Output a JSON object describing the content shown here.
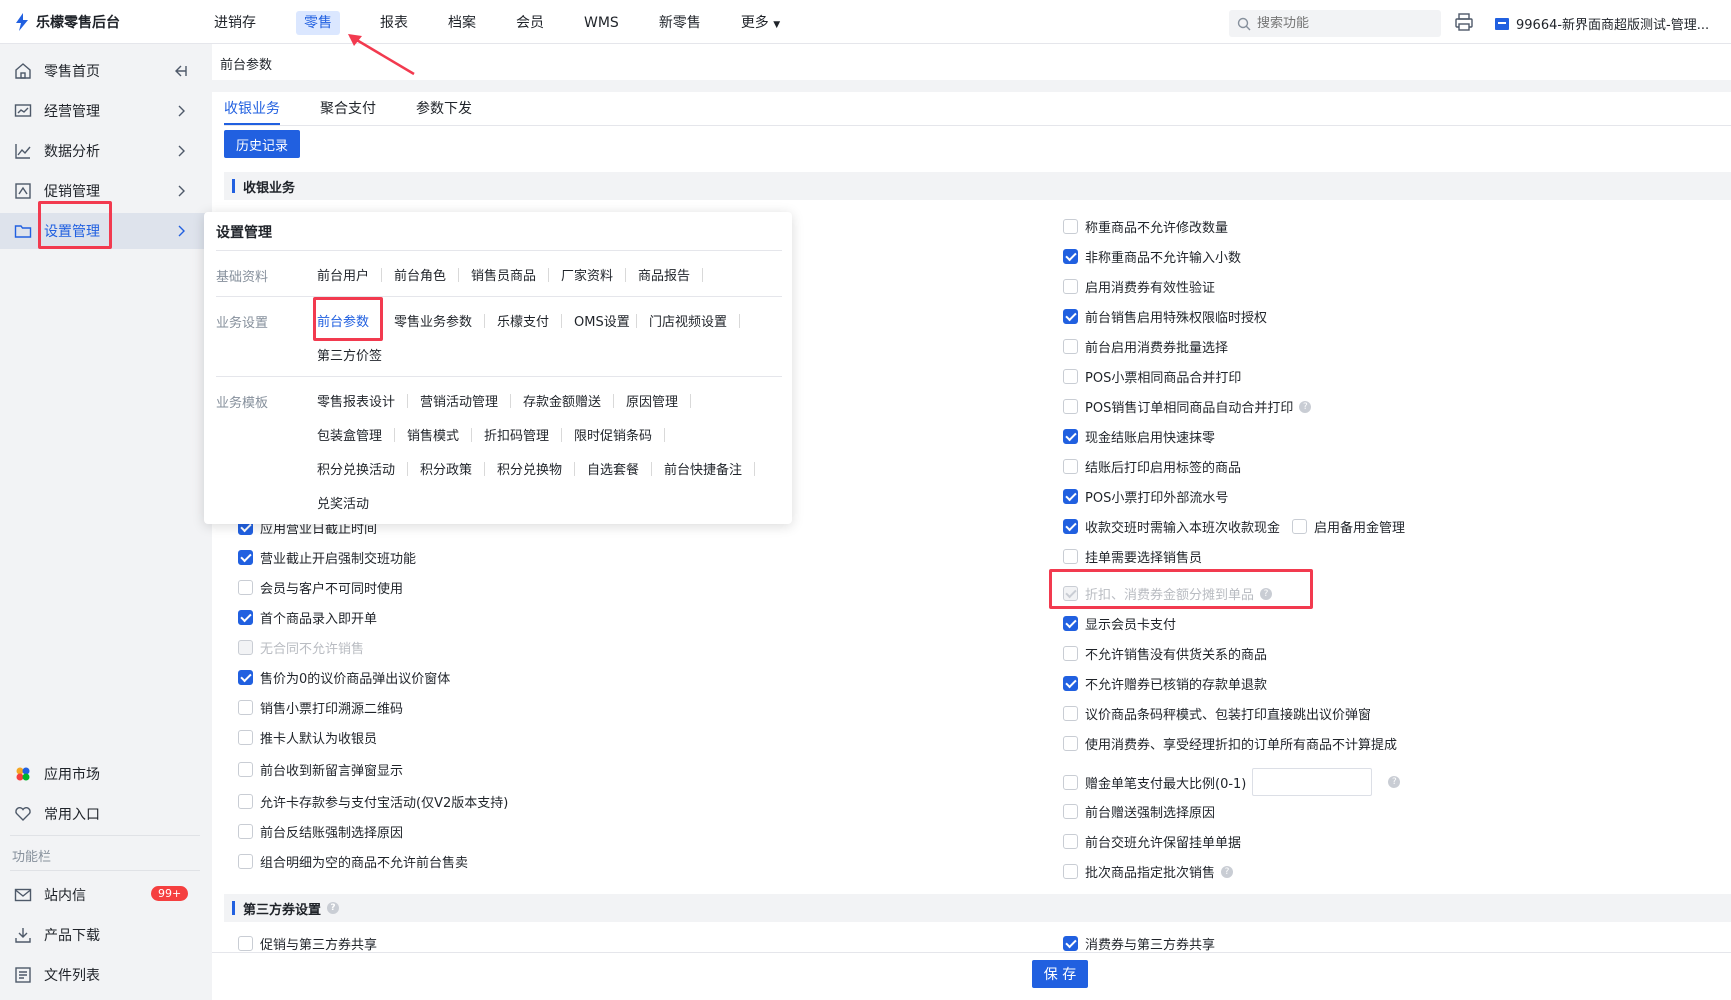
{
  "brand": {
    "name": "乐檬零售后台"
  },
  "topnav": {
    "items": [
      "进销存",
      "零售",
      "报表",
      "档案",
      "会员",
      "WMS",
      "新零售",
      "更多"
    ],
    "active": 1
  },
  "search": {
    "placeholder": "搜索功能"
  },
  "store": {
    "label": "99664-新界面商超版测试-管理..."
  },
  "sidebar": {
    "items": [
      {
        "label": "零售首页"
      },
      {
        "label": "经营管理"
      },
      {
        "label": "数据分析"
      },
      {
        "label": "促销管理"
      },
      {
        "label": "设置管理"
      }
    ],
    "bottom": [
      {
        "label": "应用市场"
      },
      {
        "label": "常用入口"
      }
    ],
    "section_label": "功能栏",
    "tools": [
      {
        "label": "站内信",
        "badge": "99+"
      },
      {
        "label": "产品下载"
      },
      {
        "label": "文件列表"
      }
    ]
  },
  "page_tab": "前台参数",
  "subtabs": [
    "收银业务",
    "聚合支付",
    "参数下发"
  ],
  "history_button": "历史记录",
  "section1": "收银业务",
  "section2": "第三方券设置",
  "left_options": [
    {
      "label": "应用营业日截止时间",
      "checked": true,
      "disabled": false
    },
    {
      "label": "营业截止开启强制交班功能",
      "checked": true,
      "disabled": false
    },
    {
      "label": "会员与客户不可同时使用",
      "checked": false,
      "disabled": false
    },
    {
      "label": "首个商品录入即开单",
      "checked": true,
      "disabled": false
    },
    {
      "label": "无合同不允许销售",
      "checked": false,
      "disabled": true
    },
    {
      "label": "售价为0的议价商品弹出议价窗体",
      "checked": true,
      "disabled": false
    },
    {
      "label": "销售小票打印溯源二维码",
      "checked": false,
      "disabled": false
    },
    {
      "label": "推卡人默认为收银员",
      "checked": false,
      "disabled": false
    },
    {
      "label": "前台收到新留言弹窗显示",
      "checked": false,
      "disabled": false
    },
    {
      "label": "允许卡存款参与支付宝活动(仅V2版本支持)",
      "checked": false,
      "disabled": false
    },
    {
      "label": "前台反结账强制选择原因",
      "checked": false,
      "disabled": false
    },
    {
      "label": "组合明细为空的商品不允许前台售卖",
      "checked": false,
      "disabled": false
    }
  ],
  "right_options": [
    {
      "label": "称重商品不允许修改数量",
      "checked": false
    },
    {
      "label": "非称重商品不允许输入小数",
      "checked": true
    },
    {
      "label": "启用消费券有效性验证",
      "checked": false
    },
    {
      "label": "前台销售启用特殊权限临时授权",
      "checked": true
    },
    {
      "label": "前台启用消费券批量选择",
      "checked": false
    },
    {
      "label": "POS小票相同商品合并打印",
      "checked": false
    },
    {
      "label": "POS销售订单相同商品自动合并打印",
      "checked": false,
      "help": true
    },
    {
      "label": "现金结账启用快速抹零",
      "checked": true
    },
    {
      "label": "结账后打印启用标签的商品",
      "checked": false
    },
    {
      "label": "POS小票打印外部流水号",
      "checked": true
    },
    {
      "label": "收款交班时需输入本班次收款现金",
      "checked": true,
      "extra": "启用备用金管理"
    },
    {
      "label": "挂单需要选择销售员",
      "checked": false
    },
    {
      "label": "折扣、消费券金额分摊到单品",
      "checked": true,
      "disabled": true,
      "help": true
    },
    {
      "label": "显示会员卡支付",
      "checked": true
    },
    {
      "label": "不允许销售没有供货关系的商品",
      "checked": false
    },
    {
      "label": "不允许赠券已核销的存款单退款",
      "checked": true
    },
    {
      "label": "议价商品条码秤模式、包装打印直接跳出议价弹窗",
      "checked": false
    },
    {
      "label": "使用消费券、享受经理折扣的订单所有商品不计算提成",
      "checked": false
    },
    {
      "label": "赠金单笔支付最大比例(0-1)",
      "checked": false,
      "input": true,
      "help": true
    },
    {
      "label": "前台赠送强制选择原因",
      "checked": false
    },
    {
      "label": "前台交班允许保留挂单单据",
      "checked": false
    },
    {
      "label": "批次商品指定批次销售",
      "checked": false,
      "help": true
    }
  ],
  "third_left": {
    "label": "促销与第三方券共享",
    "checked": false
  },
  "third_right": {
    "label": "消费券与第三方券共享",
    "checked": true
  },
  "save_button": "保 存",
  "popup": {
    "title": "设置管理",
    "groups": [
      {
        "label": "基础资料",
        "links": [
          "前台用户",
          "前台角色",
          "销售员商品",
          "厂家资料",
          "商品报告"
        ]
      },
      {
        "label": "业务设置",
        "links": [
          "前台参数",
          "零售业务参数",
          "乐檬支付",
          "OMS设置",
          "门店视频设置",
          "第三方价签"
        ]
      },
      {
        "label": "业务模板",
        "links": [
          "零售报表设计",
          "营销活动管理",
          "存款金额赠送",
          "原因管理",
          "包装盒管理",
          "销售模式",
          "折扣码管理",
          "限时促销条码",
          "积分兑换活动",
          "积分政策",
          "积分兑换物",
          "自选套餐",
          "前台快捷备注",
          "兑奖活动"
        ]
      }
    ]
  },
  "colors": {
    "accent": "#2160e0",
    "annotation": "#f23a4f",
    "badge": "#f53f3f"
  }
}
